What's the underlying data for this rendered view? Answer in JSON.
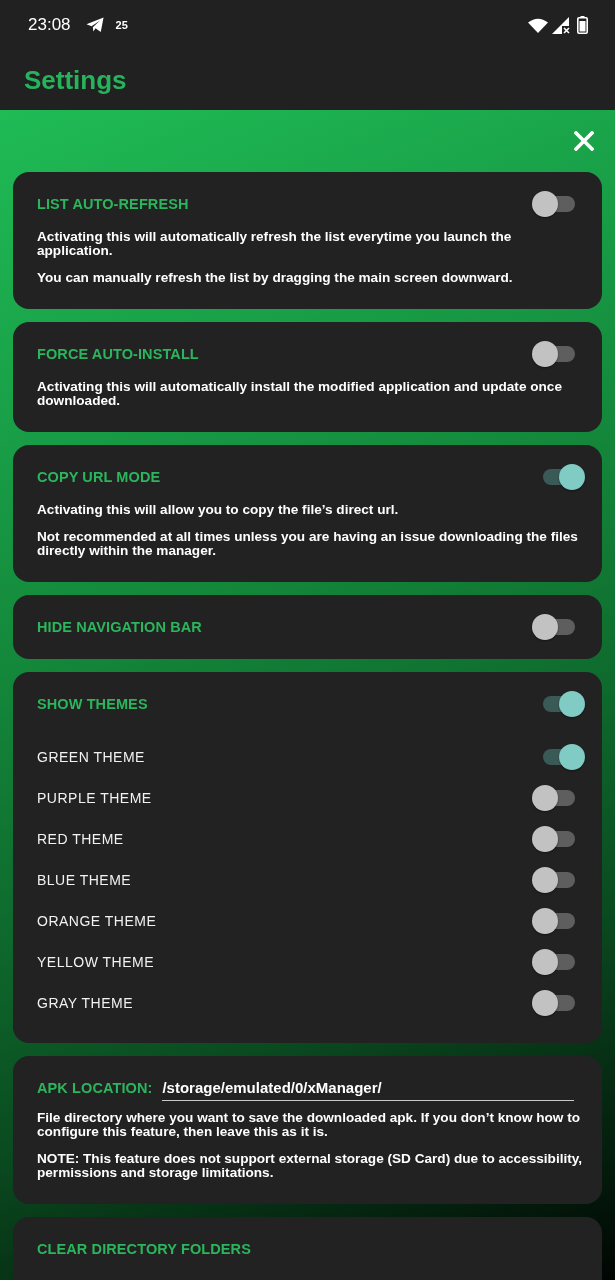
{
  "status_bar": {
    "time": "23:08",
    "notification_count": "25"
  },
  "app_bar": {
    "title": "Settings"
  },
  "settings": [
    {
      "kind": "toggle",
      "title": "LIST AUTO-REFRESH",
      "on": false,
      "description": [
        "Activating this will automatically refresh the list everytime you launch the application.",
        "You can manually refresh the list by dragging the main screen downward."
      ]
    },
    {
      "kind": "toggle",
      "title": "FORCE AUTO-INSTALL",
      "on": false,
      "description": [
        "Activating this will automatically install the modified application and update once downloaded."
      ]
    },
    {
      "kind": "toggle",
      "title": "COPY URL MODE",
      "on": true,
      "description": [
        "Activating this will allow you to copy the file’s direct url.",
        "Not recommended at all times unless you are having an issue downloading the files directly within the manager."
      ]
    },
    {
      "kind": "toggle",
      "title": "HIDE NAVIGATION BAR",
      "on": false
    },
    {
      "kind": "toggle_group",
      "title": "SHOW THEMES",
      "on": true,
      "options": [
        {
          "label": "GREEN THEME",
          "on": true
        },
        {
          "label": "PURPLE THEME",
          "on": false
        },
        {
          "label": "RED THEME",
          "on": false
        },
        {
          "label": "BLUE THEME",
          "on": false
        },
        {
          "label": "ORANGE THEME",
          "on": false
        },
        {
          "label": "YELLOW THEME",
          "on": false
        },
        {
          "label": "GRAY THEME",
          "on": false
        }
      ]
    },
    {
      "kind": "path",
      "title": "APK LOCATION:",
      "value": "/storage/emulated/0/xManager/",
      "description": [
        "File directory where you want to save the downloaded apk. If you don’t know how to configure this feature, then leave this as it is.",
        "NOTE: This feature does not support external storage (SD Card) due to accessibility, permissions and storage limitations."
      ]
    },
    {
      "kind": "action",
      "title": "CLEAR DIRECTORY FOLDERS"
    }
  ]
}
